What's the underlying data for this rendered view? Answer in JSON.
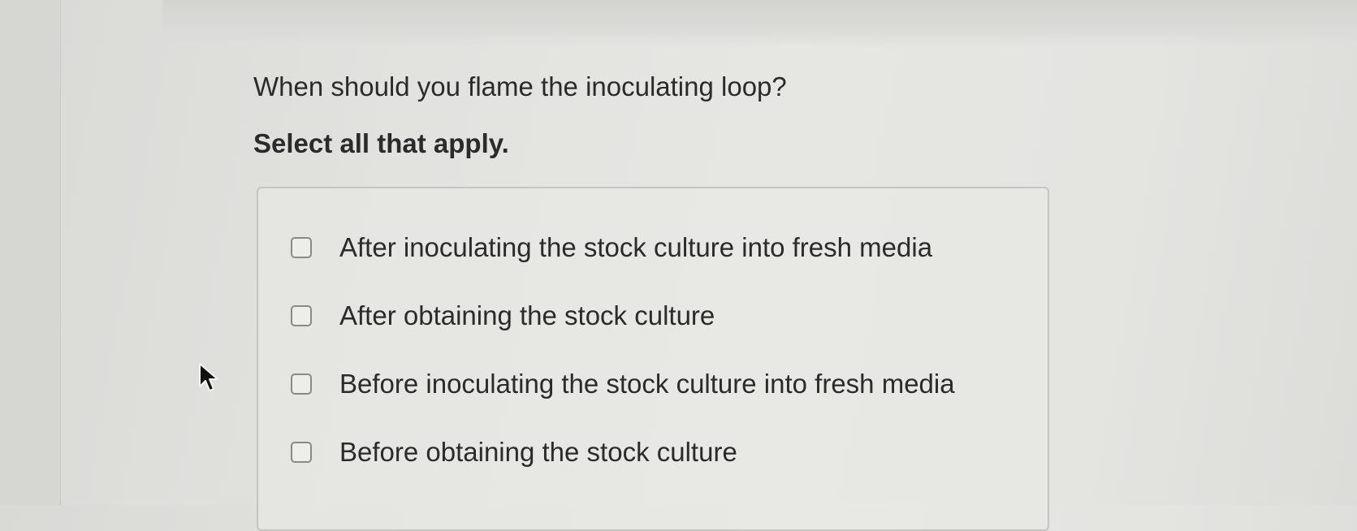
{
  "question": {
    "text": "When should you flame the inoculating loop?",
    "instruction": "Select all that apply."
  },
  "options": [
    {
      "label": "After inoculating the stock culture into fresh media",
      "checked": false
    },
    {
      "label": "After obtaining the stock culture",
      "checked": false
    },
    {
      "label": "Before inoculating the stock culture into fresh media",
      "checked": false
    },
    {
      "label": "Before obtaining the stock culture",
      "checked": false
    }
  ],
  "icons": {
    "cursor": "mouse-pointer-icon"
  },
  "colors": {
    "background": "#e3e3e0",
    "text": "#2b2b2b",
    "box_border": "#c4c4c1",
    "checkbox_border": "#8a8a87"
  }
}
